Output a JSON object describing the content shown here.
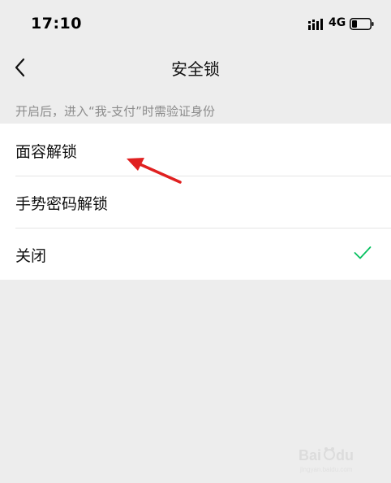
{
  "status_bar": {
    "time": "17:10",
    "network": "4G",
    "icons": [
      "signal-bars-icon",
      "battery-icon"
    ]
  },
  "nav": {
    "title": "安全锁",
    "back_icon": "chevron-left-icon"
  },
  "hint": "开启后，进入“我-支付”时需验证身份",
  "options": [
    {
      "label": "面容解锁",
      "selected": false
    },
    {
      "label": "手势密码解锁",
      "selected": false
    },
    {
      "label": "关闭",
      "selected": true
    }
  ],
  "colors": {
    "background": "#ededed",
    "card": "#ffffff",
    "check": "#07c160",
    "annotation_arrow": "#e02020",
    "hint_text": "#8c8c8c"
  },
  "watermark": {
    "brand": "Bai du 经验",
    "sub": "jingyan.baidu.com"
  }
}
